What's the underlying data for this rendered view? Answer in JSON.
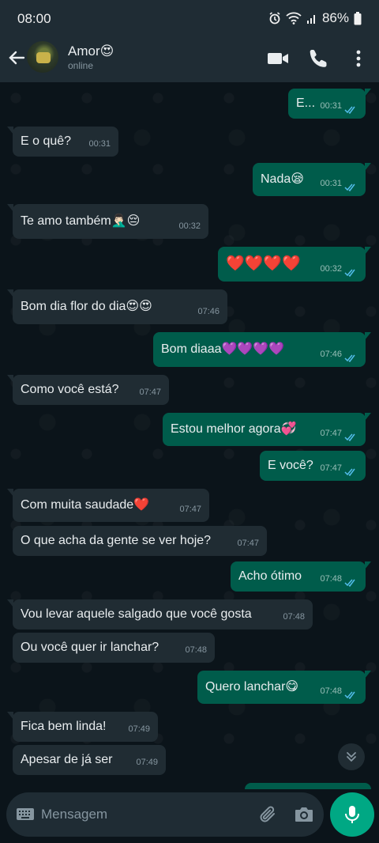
{
  "status_bar": {
    "time": "08:00",
    "battery": "86%"
  },
  "header": {
    "contact_name": "Amor😍",
    "status": "online"
  },
  "messages": [
    {
      "dir": "out",
      "text": "E...",
      "time": "00:31"
    },
    {
      "dir": "in",
      "text": "E o quê?",
      "time": "00:31"
    },
    {
      "dir": "out",
      "text": "Nada😪",
      "time": "00:31"
    },
    {
      "dir": "in",
      "text": "Te amo também🤦🏻‍♂️😔",
      "time": "00:32"
    },
    {
      "dir": "out",
      "text": "❤️❤️❤️❤️",
      "time": "00:32"
    },
    {
      "dir": "in",
      "text": "Bom dia flor do dia😍😍",
      "time": "07:46"
    },
    {
      "dir": "out",
      "text": "Bom diaaa💜💜💜💜",
      "time": "07:46"
    },
    {
      "dir": "in",
      "text": "Como você está?",
      "time": "07:47"
    },
    {
      "dir": "out",
      "text": "Estou melhor agora💞",
      "time": "07:47"
    },
    {
      "dir": "out",
      "text": "E você?",
      "time": "07:47"
    },
    {
      "dir": "in",
      "text": "Com muita saudade❤️",
      "time": "07:47"
    },
    {
      "dir": "in",
      "text": "O que acha da gente se ver hoje?",
      "time": "07:47"
    },
    {
      "dir": "out",
      "text": "Acho ótimo",
      "time": "07:48"
    },
    {
      "dir": "in",
      "text": "Vou levar aquele salgado que você gosta",
      "time": "07:48"
    },
    {
      "dir": "in",
      "text": "Ou você quer ir lanchar?",
      "time": "07:48"
    },
    {
      "dir": "out",
      "text": "Quero lanchar😋",
      "time": "07:48"
    },
    {
      "dir": "in",
      "text": "Fica bem linda!",
      "time": "07:49"
    },
    {
      "dir": "in",
      "text": "Apesar de já ser",
      "time": "07:49"
    }
  ],
  "input": {
    "placeholder": "Mensagem"
  },
  "colors": {
    "incoming_bubble": "#202c33",
    "outgoing_bubble": "#005c4b",
    "accent": "#00a884",
    "read_ticks": "#53bdeb"
  }
}
